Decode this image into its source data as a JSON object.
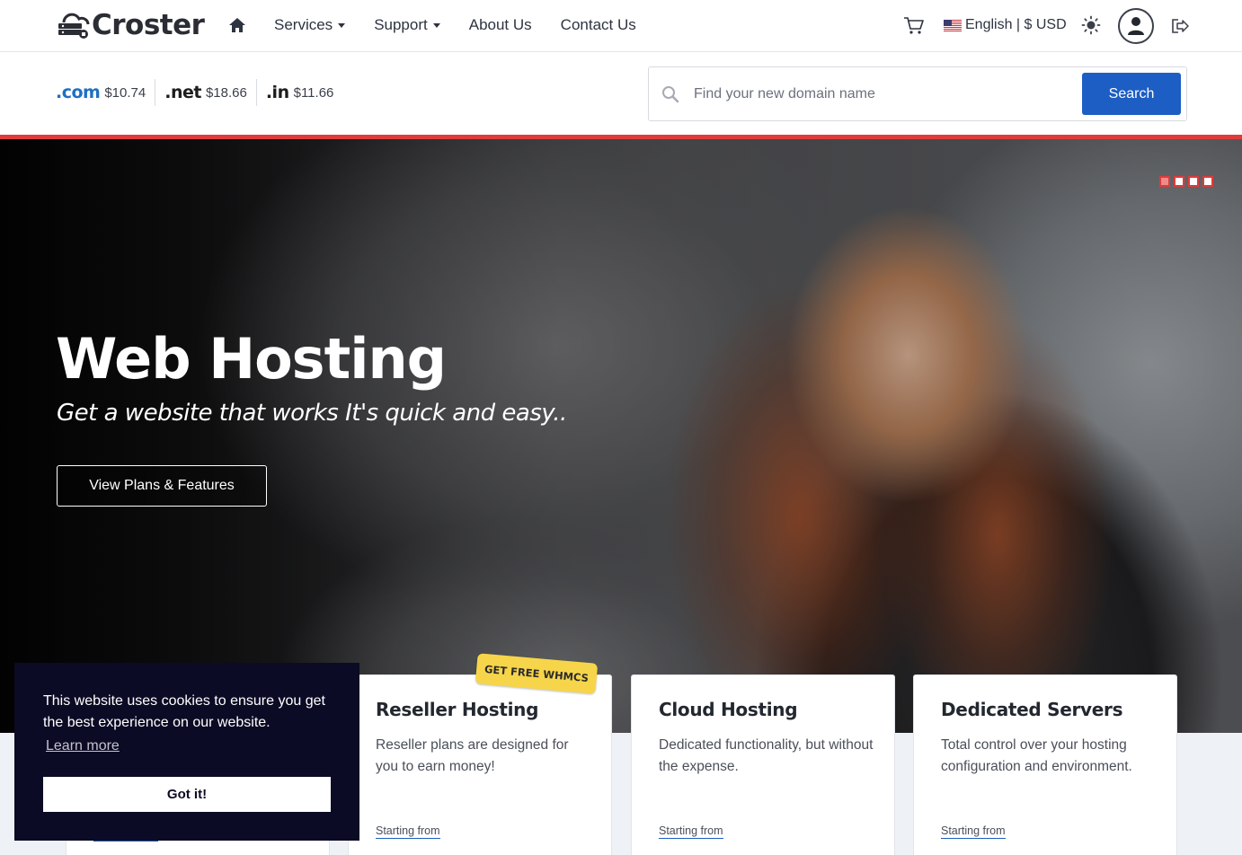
{
  "header": {
    "brand": "Croster",
    "nav": [
      {
        "label": "Services",
        "has_dropdown": true
      },
      {
        "label": "Support",
        "has_dropdown": true
      },
      {
        "label": "About Us",
        "has_dropdown": false
      },
      {
        "label": "Contact Us",
        "has_dropdown": false
      }
    ],
    "locale": "English | $ USD",
    "icons": {
      "home": "home-icon",
      "cart": "cart-icon",
      "theme": "sun-icon",
      "account": "user-icon",
      "logout": "logout-icon"
    }
  },
  "domain_bar": {
    "tlds": [
      {
        "name": ".com",
        "price": "$10.74"
      },
      {
        "name": ".net",
        "price": "$18.66"
      },
      {
        "name": ".in",
        "price": "$11.66"
      }
    ],
    "search": {
      "placeholder": "Find your new domain name",
      "value": "",
      "button": "Search"
    }
  },
  "hero": {
    "title": "Web Hosting",
    "subtitle": "Get a website that works It's quick and easy..",
    "cta": "View Plans & Features",
    "slide_count": 4,
    "active_slide": 1
  },
  "cards": [
    {
      "title": "Reseller Hosting",
      "description": "Reseller plans are designed for you to earn money!",
      "starting": "Starting from",
      "ribbon": "GET FREE WHMCS"
    },
    {
      "title": "Cloud Hosting",
      "description": "Dedicated functionality, but without the expense.",
      "starting": "Starting from"
    },
    {
      "title": "Dedicated Servers",
      "description": "Total control over your hosting configuration and environment.",
      "starting": "Starting from"
    }
  ],
  "cookie": {
    "message": "This website uses cookies to ensure you get the best experience on our website.",
    "learn_more": "Learn more",
    "accept": "Got it!"
  },
  "colors": {
    "accent": "#1d5ec4",
    "brand_red": "#e03b3b",
    "cookie_bg": "#0c0b25",
    "ribbon": "#f7d54a"
  }
}
